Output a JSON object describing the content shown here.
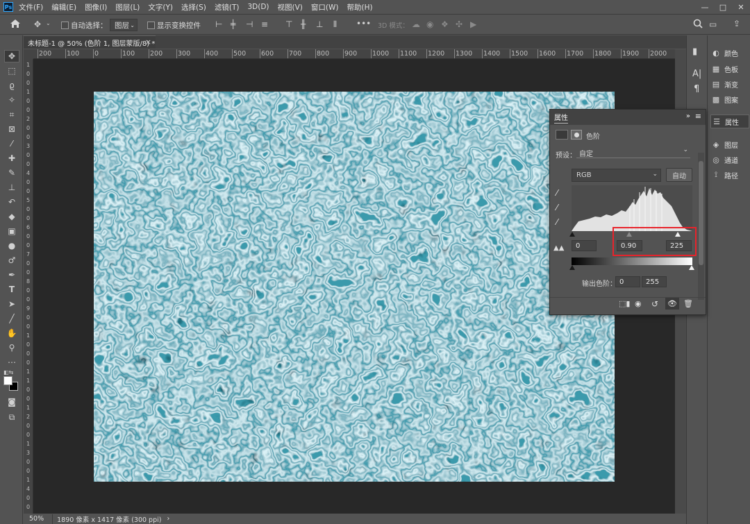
{
  "menu": {
    "logo": "Ps",
    "items": [
      "文件(F)",
      "编辑(E)",
      "图像(I)",
      "图层(L)",
      "文字(Y)",
      "选择(S)",
      "滤镜(T)",
      "3D(D)",
      "视图(V)",
      "窗口(W)",
      "帮助(H)"
    ],
    "window_controls": [
      "—",
      "□",
      "✕"
    ]
  },
  "options": {
    "auto_select_label": "自动选择：",
    "auto_select_value": "图层",
    "show_transform_label": "显示变换控件",
    "mode_3d_label": "3D 模式："
  },
  "document": {
    "tab_title": "未标题-1 @ 50% (色阶 1, 图层蒙版/8) *",
    "close": "×"
  },
  "ruler": {
    "h_ticks": [
      "200",
      "100",
      "0",
      "100",
      "200",
      "300",
      "400",
      "500",
      "600",
      "700",
      "800",
      "900",
      "1000",
      "1100",
      "1200",
      "1300",
      "1400",
      "1500",
      "1600",
      "1700",
      "1800",
      "1900",
      "2000"
    ],
    "v_ticks": [
      "1",
      "0",
      "0",
      "1",
      "0",
      "0",
      "2",
      "0",
      "0",
      "3",
      "0",
      "0",
      "4",
      "0",
      "0",
      "5",
      "0",
      "0",
      "6",
      "0",
      "0",
      "7",
      "0",
      "0",
      "8",
      "0",
      "0",
      "9",
      "0",
      "0",
      "1",
      "0",
      "0",
      "0",
      "1",
      "1",
      "0",
      "0",
      "1",
      "2",
      "0",
      "0",
      "1",
      "3",
      "0",
      "0",
      "1",
      "4",
      "0",
      "0"
    ]
  },
  "status": {
    "zoom": "50%",
    "doc_size": "1890 像素 x 1417 像素 (300 ppi)",
    "arrow": "›"
  },
  "dock_panels": [
    {
      "icon": "palette-icon",
      "glyph": "◐",
      "label": "颜色"
    },
    {
      "icon": "swatches-icon",
      "glyph": "▦",
      "label": "色板"
    },
    {
      "icon": "gradient-icon",
      "glyph": "▤",
      "label": "渐变"
    },
    {
      "icon": "patterns-icon",
      "glyph": "▩",
      "label": "图案"
    },
    {
      "icon": "properties-icon",
      "glyph": "☰",
      "label": "属性"
    },
    {
      "icon": "layers-icon",
      "glyph": "◈",
      "label": "图层"
    },
    {
      "icon": "channels-icon",
      "glyph": "◎",
      "label": "通道"
    },
    {
      "icon": "paths-icon",
      "glyph": "⟟",
      "label": "路径"
    }
  ],
  "properties": {
    "title": "属性",
    "adjustment": "色阶",
    "preset_label": "预设：",
    "preset_value": "自定",
    "channel": "RGB",
    "auto_button": "自动",
    "input_black": "0",
    "input_gamma": "0.90",
    "input_white": "225",
    "output_label": "输出色阶：",
    "output_black": "0",
    "output_white": "255",
    "input_black_level": 0,
    "input_gamma_position": 0.49,
    "input_white_level": 225
  },
  "colors": {
    "highlight_box": "#e8232b",
    "image_base": "#3a9aac"
  }
}
